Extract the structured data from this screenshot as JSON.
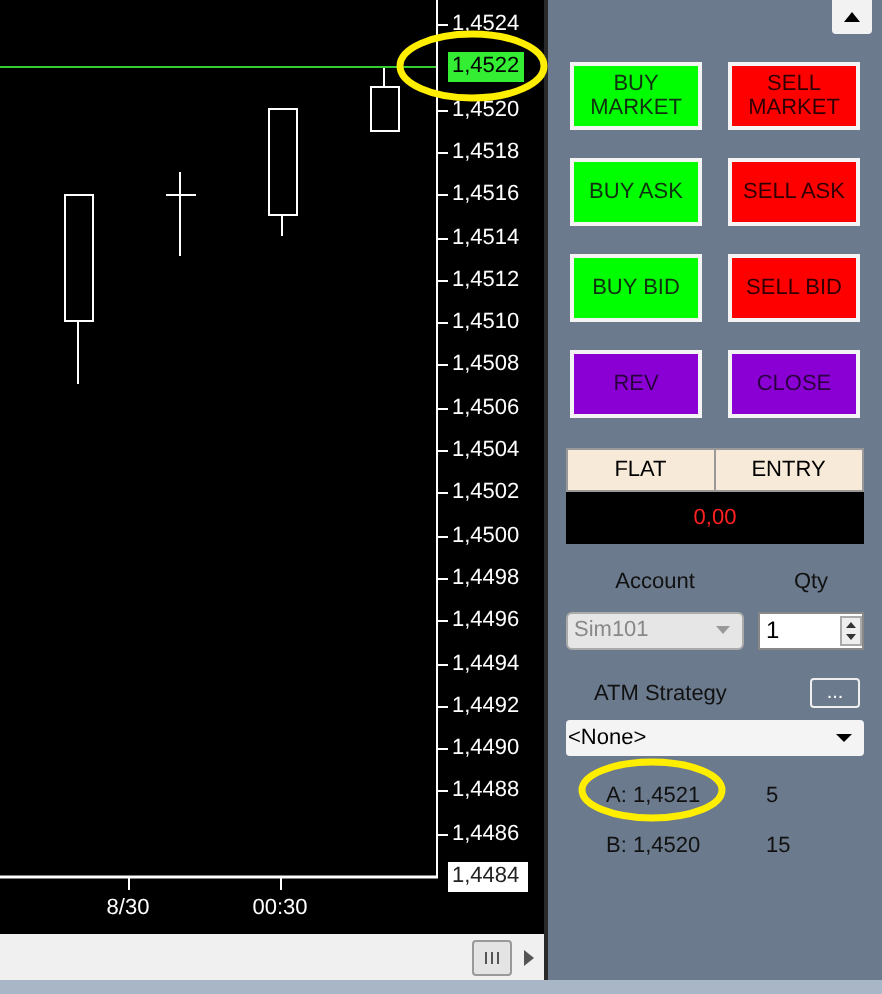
{
  "chart": {
    "price_labels": [
      "1,4524",
      "1,4520",
      "1,4518",
      "1,4516",
      "1,4514",
      "1,4512",
      "1,4510",
      "1,4508",
      "1,4506",
      "1,4504",
      "1,4502",
      "1,4500",
      "1,4498",
      "1,4496",
      "1,4494",
      "1,4492",
      "1,4490",
      "1,4488",
      "1,4486"
    ],
    "current_price": "1,4522",
    "last_label": "1,4484",
    "time_labels": [
      "8/30",
      "00:30"
    ]
  },
  "buttons": [
    {
      "label": "BUY MARKET",
      "kind": "buy"
    },
    {
      "label": "SELL MARKET",
      "kind": "sell"
    },
    {
      "label": "BUY ASK",
      "kind": "buy"
    },
    {
      "label": "SELL ASK",
      "kind": "sell"
    },
    {
      "label": "BUY BID",
      "kind": "buy"
    },
    {
      "label": "SELL BID",
      "kind": "sell"
    },
    {
      "label": "REV",
      "kind": "action"
    },
    {
      "label": "CLOSE",
      "kind": "action"
    }
  ],
  "position": {
    "columns": [
      "FLAT",
      "ENTRY"
    ],
    "pnl": "0,00"
  },
  "account": {
    "label": "Account",
    "value": "Sim101",
    "disabled": true
  },
  "qty": {
    "label": "Qty",
    "value": "1"
  },
  "atm": {
    "label": "ATM Strategy",
    "button": "...",
    "value": "<None>"
  },
  "quotes": [
    {
      "price": "A: 1,4521",
      "size": "5"
    },
    {
      "price": "B: 1,4520",
      "size": "15"
    }
  ]
}
